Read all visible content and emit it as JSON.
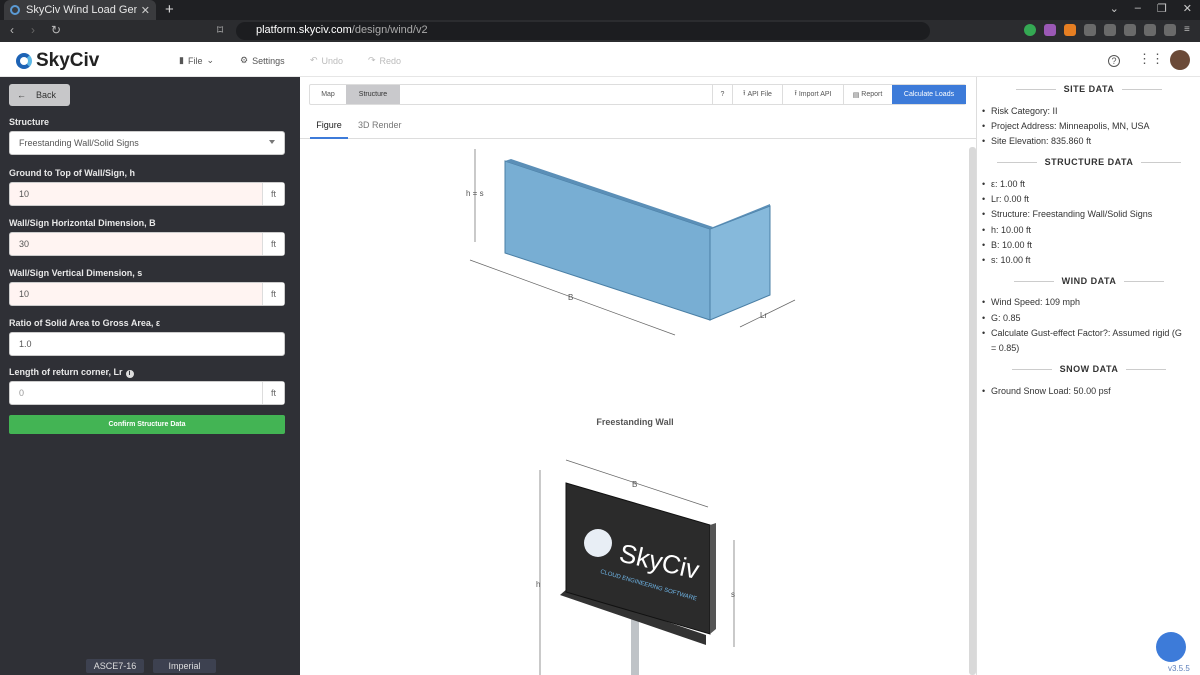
{
  "browser": {
    "tab_title": "SkyCiv Wind Load Generat",
    "url_domain": "platform.skyciv.com",
    "url_path": "/design/wind/v2"
  },
  "app": {
    "logo_text": "SkyCiv",
    "menu": {
      "file": "File",
      "settings": "Settings",
      "undo": "Undo",
      "redo": "Redo"
    },
    "help": "?"
  },
  "left_panel": {
    "back_label": "Back",
    "structure_label": "Structure",
    "structure_value": "Freestanding Wall/Solid Signs",
    "h_label": "Ground to Top of Wall/Sign, h",
    "h_value": "10",
    "b_label": "Wall/Sign Horizontal Dimension, B",
    "b_value": "30",
    "s_label": "Wall/Sign Vertical Dimension, s",
    "s_value": "10",
    "ratio_label": "Ratio of Solid Area to Gross Area, ε",
    "ratio_value": "1.0",
    "lr_label": "Length of return corner, Lr",
    "lr_placeholder": "0",
    "unit": "ft",
    "confirm_label": "Confirm Structure Data",
    "code_label": "ASCE7-16",
    "units_label": "Imperial"
  },
  "toolbar": {
    "map": "Map",
    "structure": "Structure",
    "help": "?",
    "api_file": "API File",
    "import_api": "Import API",
    "report": "Report",
    "calculate": "Calculate Loads"
  },
  "tabs": {
    "figure": "Figure",
    "render": "3D Render"
  },
  "figure": {
    "caption": "Freestanding Wall",
    "wall_h_label": "h = s",
    "wall_b_label": "B",
    "wall_lr_label": "Lr",
    "sign_b_label": "B",
    "sign_h_label": "h",
    "sign_s_label": "s",
    "sign_brand": "SkyCiv",
    "sign_tagline": "CLOUD ENGINEERING SOFTWARE"
  },
  "site_data": {
    "title": "SITE DATA",
    "items": [
      "Risk Category: II",
      "Project Address: Minneapolis, MN, USA",
      "Site Elevation: 835.860 ft"
    ]
  },
  "structure_data": {
    "title": "STRUCTURE DATA",
    "items": [
      "ε: 1.00 ft",
      "Lr: 0.00 ft",
      "Structure: Freestanding Wall/Solid Signs",
      "h: 10.00 ft",
      "B: 10.00 ft",
      "s: 10.00 ft"
    ]
  },
  "wind_data": {
    "title": "WIND DATA",
    "items": [
      "Wind Speed: 109 mph",
      "G: 0.85",
      "Calculate Gust-effect Factor?: Assumed rigid (G = 0.85)"
    ]
  },
  "snow_data": {
    "title": "SNOW DATA",
    "items": [
      "Ground Snow Load: 50.00 psf"
    ]
  },
  "version": "v3.5.5"
}
